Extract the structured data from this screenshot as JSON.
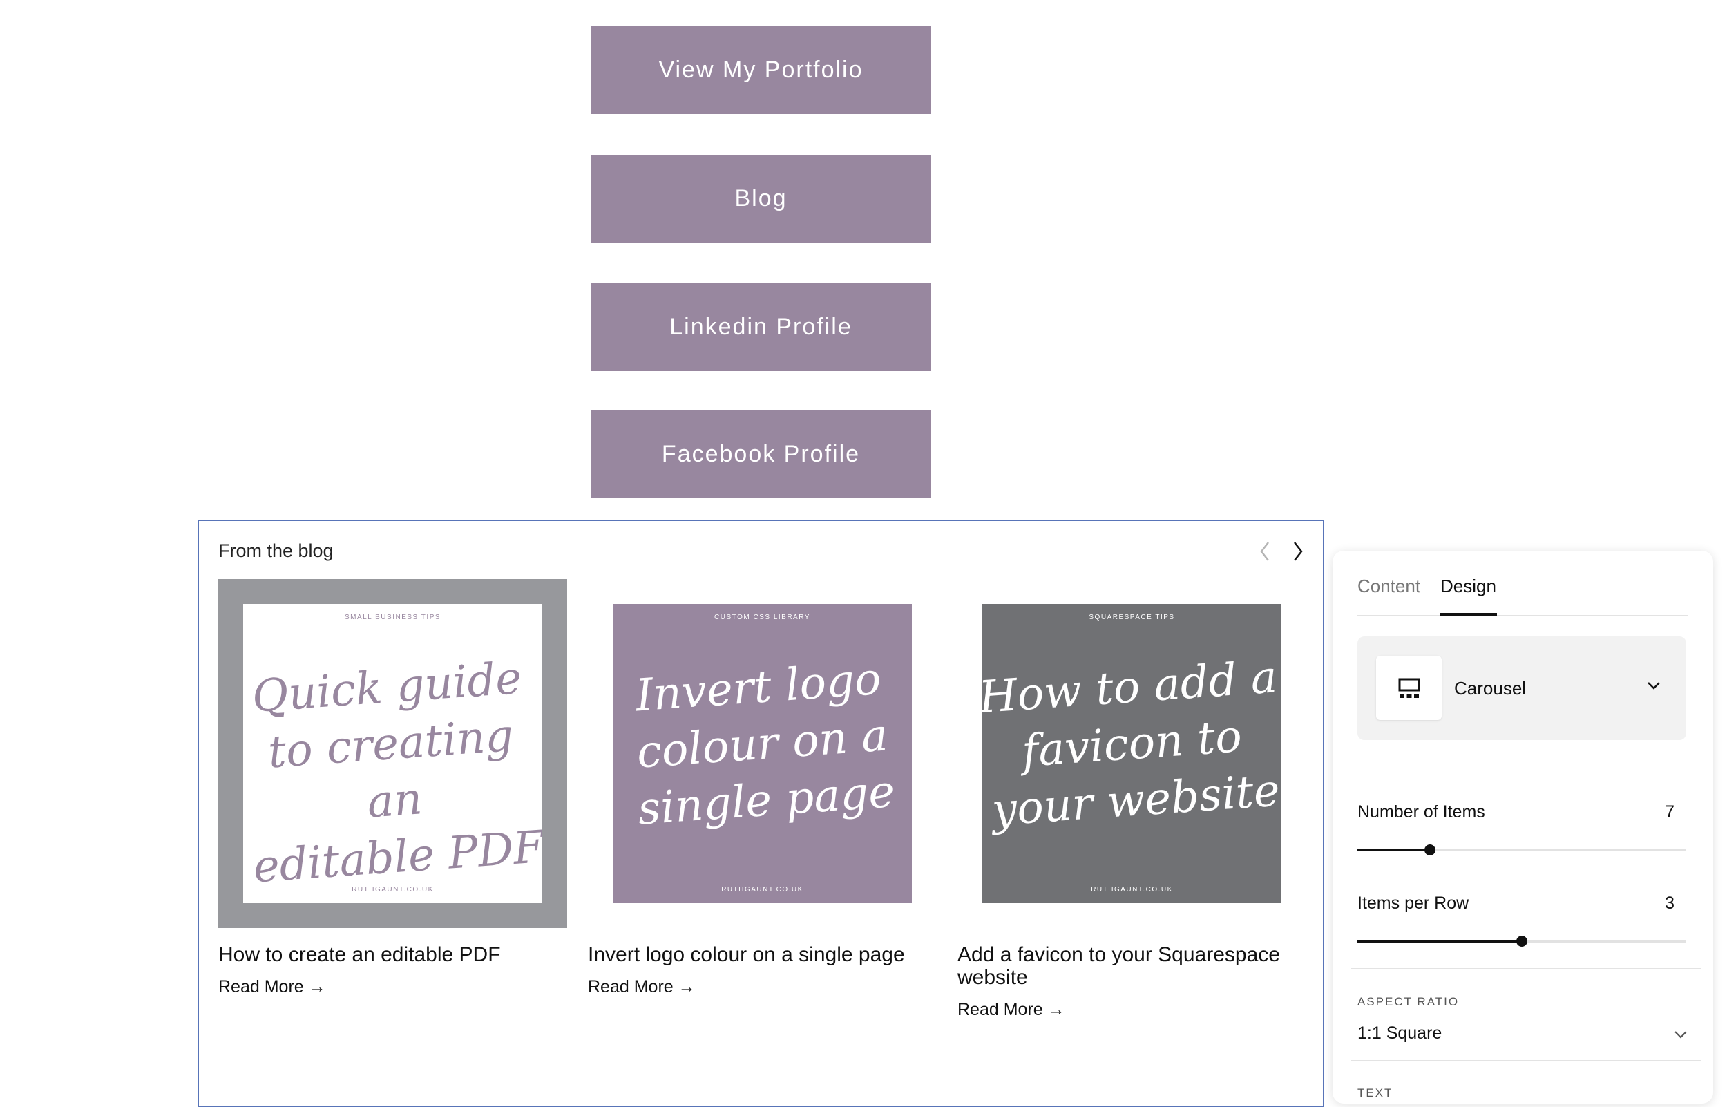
{
  "link_buttons": [
    "View My Portfolio",
    "Blog",
    "Linkedin Profile",
    "Facebook Profile"
  ],
  "blog": {
    "title": "From the blog",
    "cards": [
      {
        "category": "SMALL BUSINESS TIPS",
        "script_lines": [
          "Quick guide",
          "to creating an",
          "editable PDF"
        ],
        "url": "RUTHGAUNT.CO.UK",
        "title": "How to create an editable PDF",
        "read_more": "Read More →",
        "frame_color": "#97989c",
        "bg_color": "#ffffff",
        "text_color": "#98879f"
      },
      {
        "category": "CUSTOM CSS LIBRARY",
        "script_lines": [
          "Invert logo",
          "colour on a",
          "single page"
        ],
        "url": "RUTHGAUNT.CO.UK",
        "title": "Invert logo colour on a single page",
        "read_more": "Read More →",
        "frame_color": "#ffffff",
        "bg_color": "#98879f",
        "text_color": "#ffffff"
      },
      {
        "category": "SQUARESPACE TIPS",
        "script_lines": [
          "How to add a",
          "favicon to",
          "your website"
        ],
        "url": "RUTHGAUNT.CO.UK",
        "title": "Add a favicon to your Squarespace website",
        "read_more": "Read More →",
        "frame_color": "#ffffff",
        "bg_color": "#707174",
        "text_color": "#ffffff"
      }
    ]
  },
  "panel": {
    "tabs": [
      "Content",
      "Design"
    ],
    "active_tab": "Design",
    "layout_label": "Carousel",
    "number_of_items": {
      "label": "Number of Items",
      "value": "7",
      "fraction": 0.22
    },
    "items_per_row": {
      "label": "Items per Row",
      "value": "3",
      "fraction": 0.5
    },
    "aspect_ratio": {
      "label": "ASPECT RATIO",
      "value": "1:1 Square"
    },
    "text_section": "TEXT"
  },
  "colors": {
    "button_bg": "#98879f",
    "selection_border": "#5874b8"
  }
}
